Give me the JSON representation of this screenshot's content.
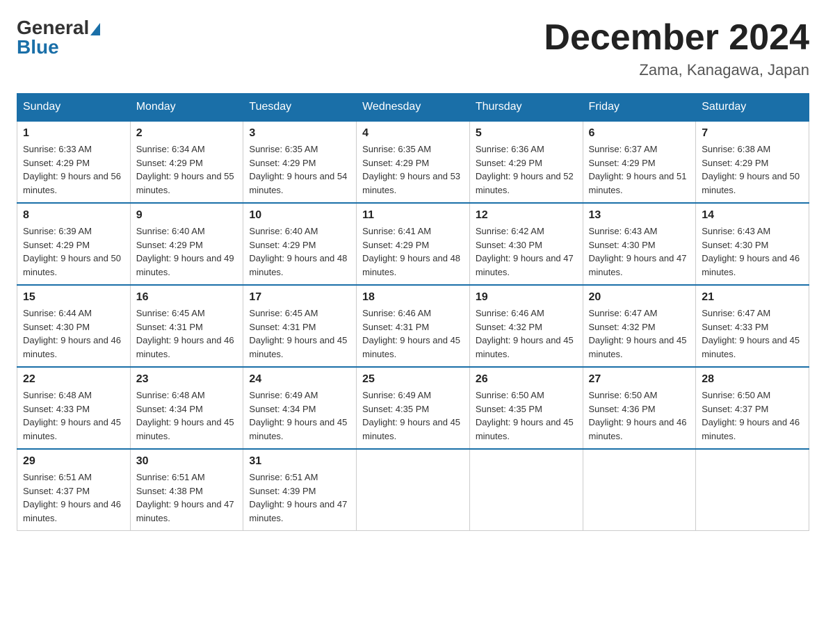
{
  "logo": {
    "general": "General",
    "blue": "Blue"
  },
  "title": {
    "month_year": "December 2024",
    "location": "Zama, Kanagawa, Japan"
  },
  "days_of_week": [
    "Sunday",
    "Monday",
    "Tuesday",
    "Wednesday",
    "Thursday",
    "Friday",
    "Saturday"
  ],
  "weeks": [
    [
      {
        "day": "1",
        "sunrise": "6:33 AM",
        "sunset": "4:29 PM",
        "daylight": "9 hours and 56 minutes."
      },
      {
        "day": "2",
        "sunrise": "6:34 AM",
        "sunset": "4:29 PM",
        "daylight": "9 hours and 55 minutes."
      },
      {
        "day": "3",
        "sunrise": "6:35 AM",
        "sunset": "4:29 PM",
        "daylight": "9 hours and 54 minutes."
      },
      {
        "day": "4",
        "sunrise": "6:35 AM",
        "sunset": "4:29 PM",
        "daylight": "9 hours and 53 minutes."
      },
      {
        "day": "5",
        "sunrise": "6:36 AM",
        "sunset": "4:29 PM",
        "daylight": "9 hours and 52 minutes."
      },
      {
        "day": "6",
        "sunrise": "6:37 AM",
        "sunset": "4:29 PM",
        "daylight": "9 hours and 51 minutes."
      },
      {
        "day": "7",
        "sunrise": "6:38 AM",
        "sunset": "4:29 PM",
        "daylight": "9 hours and 50 minutes."
      }
    ],
    [
      {
        "day": "8",
        "sunrise": "6:39 AM",
        "sunset": "4:29 PM",
        "daylight": "9 hours and 50 minutes."
      },
      {
        "day": "9",
        "sunrise": "6:40 AM",
        "sunset": "4:29 PM",
        "daylight": "9 hours and 49 minutes."
      },
      {
        "day": "10",
        "sunrise": "6:40 AM",
        "sunset": "4:29 PM",
        "daylight": "9 hours and 48 minutes."
      },
      {
        "day": "11",
        "sunrise": "6:41 AM",
        "sunset": "4:29 PM",
        "daylight": "9 hours and 48 minutes."
      },
      {
        "day": "12",
        "sunrise": "6:42 AM",
        "sunset": "4:30 PM",
        "daylight": "9 hours and 47 minutes."
      },
      {
        "day": "13",
        "sunrise": "6:43 AM",
        "sunset": "4:30 PM",
        "daylight": "9 hours and 47 minutes."
      },
      {
        "day": "14",
        "sunrise": "6:43 AM",
        "sunset": "4:30 PM",
        "daylight": "9 hours and 46 minutes."
      }
    ],
    [
      {
        "day": "15",
        "sunrise": "6:44 AM",
        "sunset": "4:30 PM",
        "daylight": "9 hours and 46 minutes."
      },
      {
        "day": "16",
        "sunrise": "6:45 AM",
        "sunset": "4:31 PM",
        "daylight": "9 hours and 46 minutes."
      },
      {
        "day": "17",
        "sunrise": "6:45 AM",
        "sunset": "4:31 PM",
        "daylight": "9 hours and 45 minutes."
      },
      {
        "day": "18",
        "sunrise": "6:46 AM",
        "sunset": "4:31 PM",
        "daylight": "9 hours and 45 minutes."
      },
      {
        "day": "19",
        "sunrise": "6:46 AM",
        "sunset": "4:32 PM",
        "daylight": "9 hours and 45 minutes."
      },
      {
        "day": "20",
        "sunrise": "6:47 AM",
        "sunset": "4:32 PM",
        "daylight": "9 hours and 45 minutes."
      },
      {
        "day": "21",
        "sunrise": "6:47 AM",
        "sunset": "4:33 PM",
        "daylight": "9 hours and 45 minutes."
      }
    ],
    [
      {
        "day": "22",
        "sunrise": "6:48 AM",
        "sunset": "4:33 PM",
        "daylight": "9 hours and 45 minutes."
      },
      {
        "day": "23",
        "sunrise": "6:48 AM",
        "sunset": "4:34 PM",
        "daylight": "9 hours and 45 minutes."
      },
      {
        "day": "24",
        "sunrise": "6:49 AM",
        "sunset": "4:34 PM",
        "daylight": "9 hours and 45 minutes."
      },
      {
        "day": "25",
        "sunrise": "6:49 AM",
        "sunset": "4:35 PM",
        "daylight": "9 hours and 45 minutes."
      },
      {
        "day": "26",
        "sunrise": "6:50 AM",
        "sunset": "4:35 PM",
        "daylight": "9 hours and 45 minutes."
      },
      {
        "day": "27",
        "sunrise": "6:50 AM",
        "sunset": "4:36 PM",
        "daylight": "9 hours and 46 minutes."
      },
      {
        "day": "28",
        "sunrise": "6:50 AM",
        "sunset": "4:37 PM",
        "daylight": "9 hours and 46 minutes."
      }
    ],
    [
      {
        "day": "29",
        "sunrise": "6:51 AM",
        "sunset": "4:37 PM",
        "daylight": "9 hours and 46 minutes."
      },
      {
        "day": "30",
        "sunrise": "6:51 AM",
        "sunset": "4:38 PM",
        "daylight": "9 hours and 47 minutes."
      },
      {
        "day": "31",
        "sunrise": "6:51 AM",
        "sunset": "4:39 PM",
        "daylight": "9 hours and 47 minutes."
      },
      null,
      null,
      null,
      null
    ]
  ]
}
